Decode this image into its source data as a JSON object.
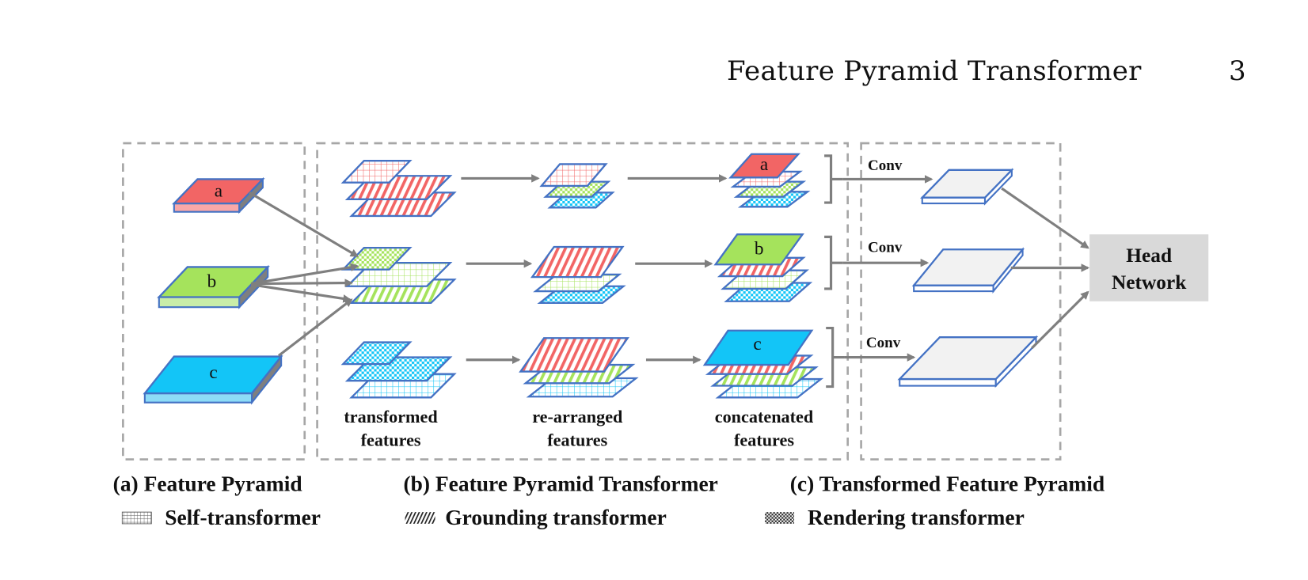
{
  "running_head": {
    "title": "Feature Pyramid Transformer",
    "page_number": "3"
  },
  "figure": {
    "panels": {
      "a": {
        "caption": "(a) Feature Pyramid",
        "levels": [
          "a",
          "b",
          "c"
        ]
      },
      "b": {
        "caption": "(b) Feature Pyramid Transformer",
        "stage_labels": [
          {
            "line1": "transformed",
            "line2": "features"
          },
          {
            "line1": "re-arranged",
            "line2": "features"
          },
          {
            "line1": "concatenated",
            "line2": "features"
          }
        ],
        "concat_tops": [
          "a",
          "b",
          "c"
        ]
      },
      "c": {
        "caption": "(c) Transformed Feature Pyramid",
        "conv_labels": [
          "Conv",
          "Conv",
          "Conv"
        ]
      }
    },
    "head": {
      "line1": "Head",
      "line2": "Network"
    },
    "legend": [
      {
        "icon": "grid-pattern-icon",
        "label": "Self-transformer"
      },
      {
        "icon": "diagonal-stripes-icon",
        "label": "Grounding transformer"
      },
      {
        "icon": "checker-pattern-icon",
        "label": "Rendering transformer"
      }
    ],
    "colors": {
      "red": "#f26565",
      "green": "#a5e35c",
      "blue": "#13c5f7",
      "outline": "#4472c4",
      "arrow": "#7f7f7f",
      "dash": "#a6a6a6",
      "head_fill": "#d9d9d9"
    }
  }
}
